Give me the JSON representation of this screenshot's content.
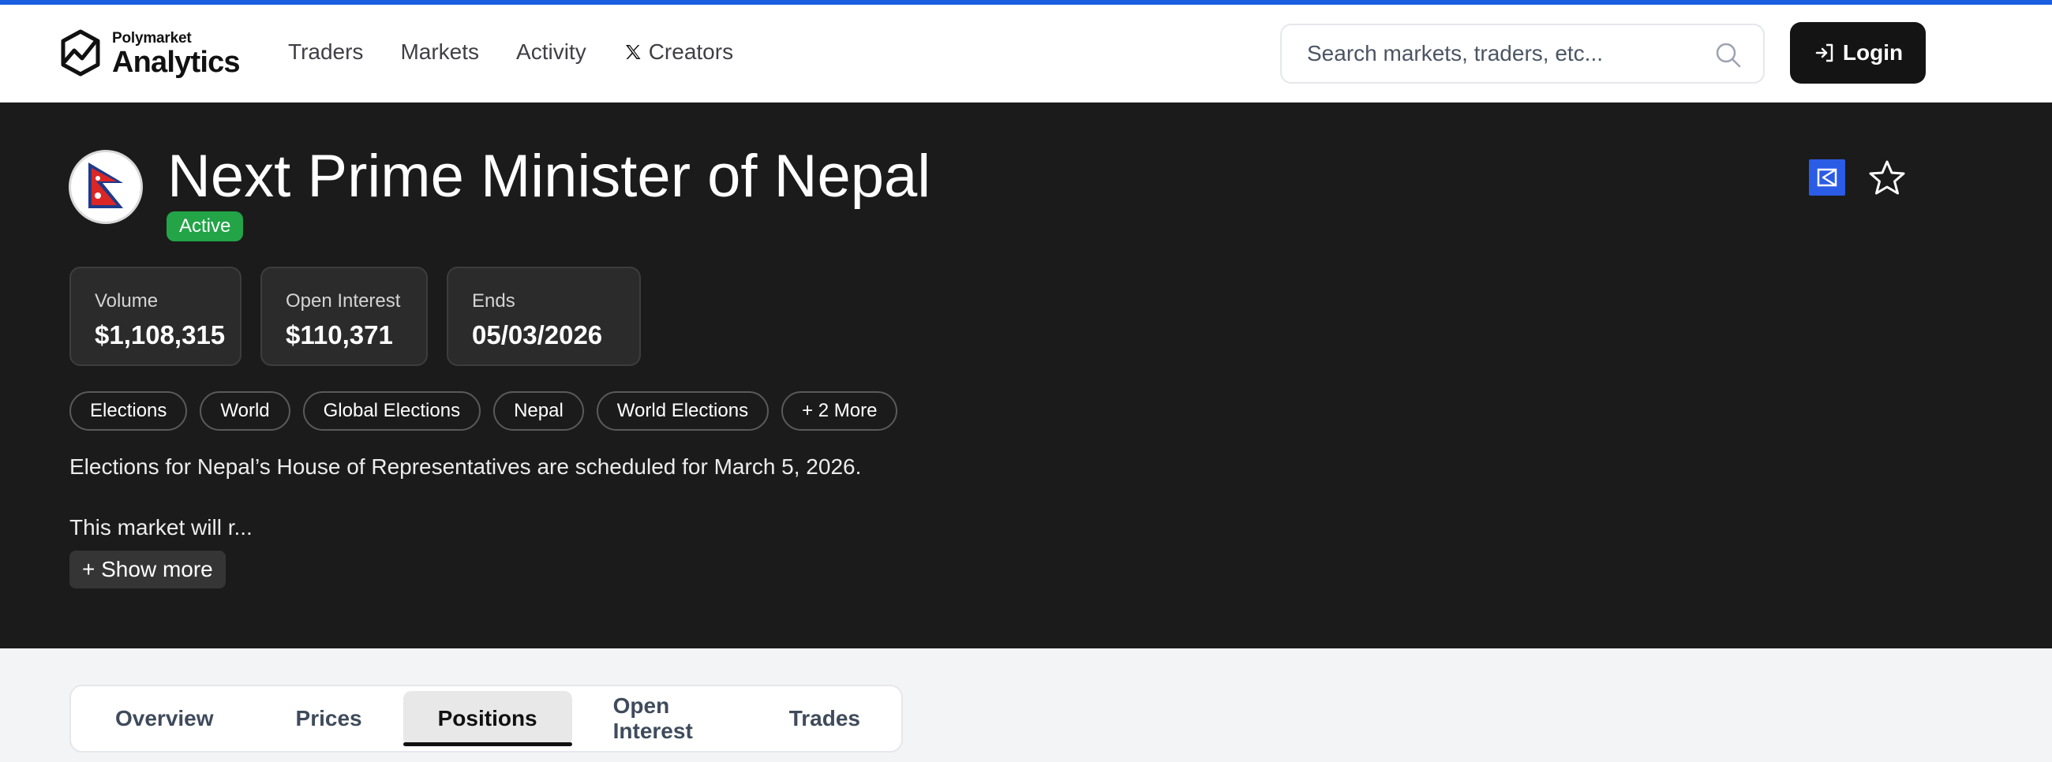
{
  "header": {
    "logo_small": "Polymarket",
    "logo_big": "Analytics",
    "nav": [
      {
        "label": "Traders"
      },
      {
        "label": "Markets"
      },
      {
        "label": "Activity"
      },
      {
        "label": "Creators"
      }
    ],
    "search_placeholder": "Search markets, traders, etc...",
    "login_label": "Login",
    "accent_color": "#1a5fe0"
  },
  "market": {
    "title": "Next Prime Minister of Nepal",
    "status": "Active",
    "stats": [
      {
        "label": "Volume",
        "value": "$1,108,315"
      },
      {
        "label": "Open Interest",
        "value": "$110,371"
      },
      {
        "label": "Ends",
        "value": "05/03/2026"
      }
    ],
    "tags": [
      "Elections",
      "World",
      "Global Elections",
      "Nepal",
      "World Elections",
      "+ 2 More"
    ],
    "description_1": "Elections for Nepal’s House of Representatives are scheduled for March 5, 2026.",
    "description_2": "This market will r...",
    "show_more": "+ Show more"
  },
  "tabs": [
    {
      "label": "Overview"
    },
    {
      "label": "Prices"
    },
    {
      "label": "Positions"
    },
    {
      "label": "Open Interest"
    },
    {
      "label": "Trades"
    }
  ],
  "active_tab": "Positions"
}
